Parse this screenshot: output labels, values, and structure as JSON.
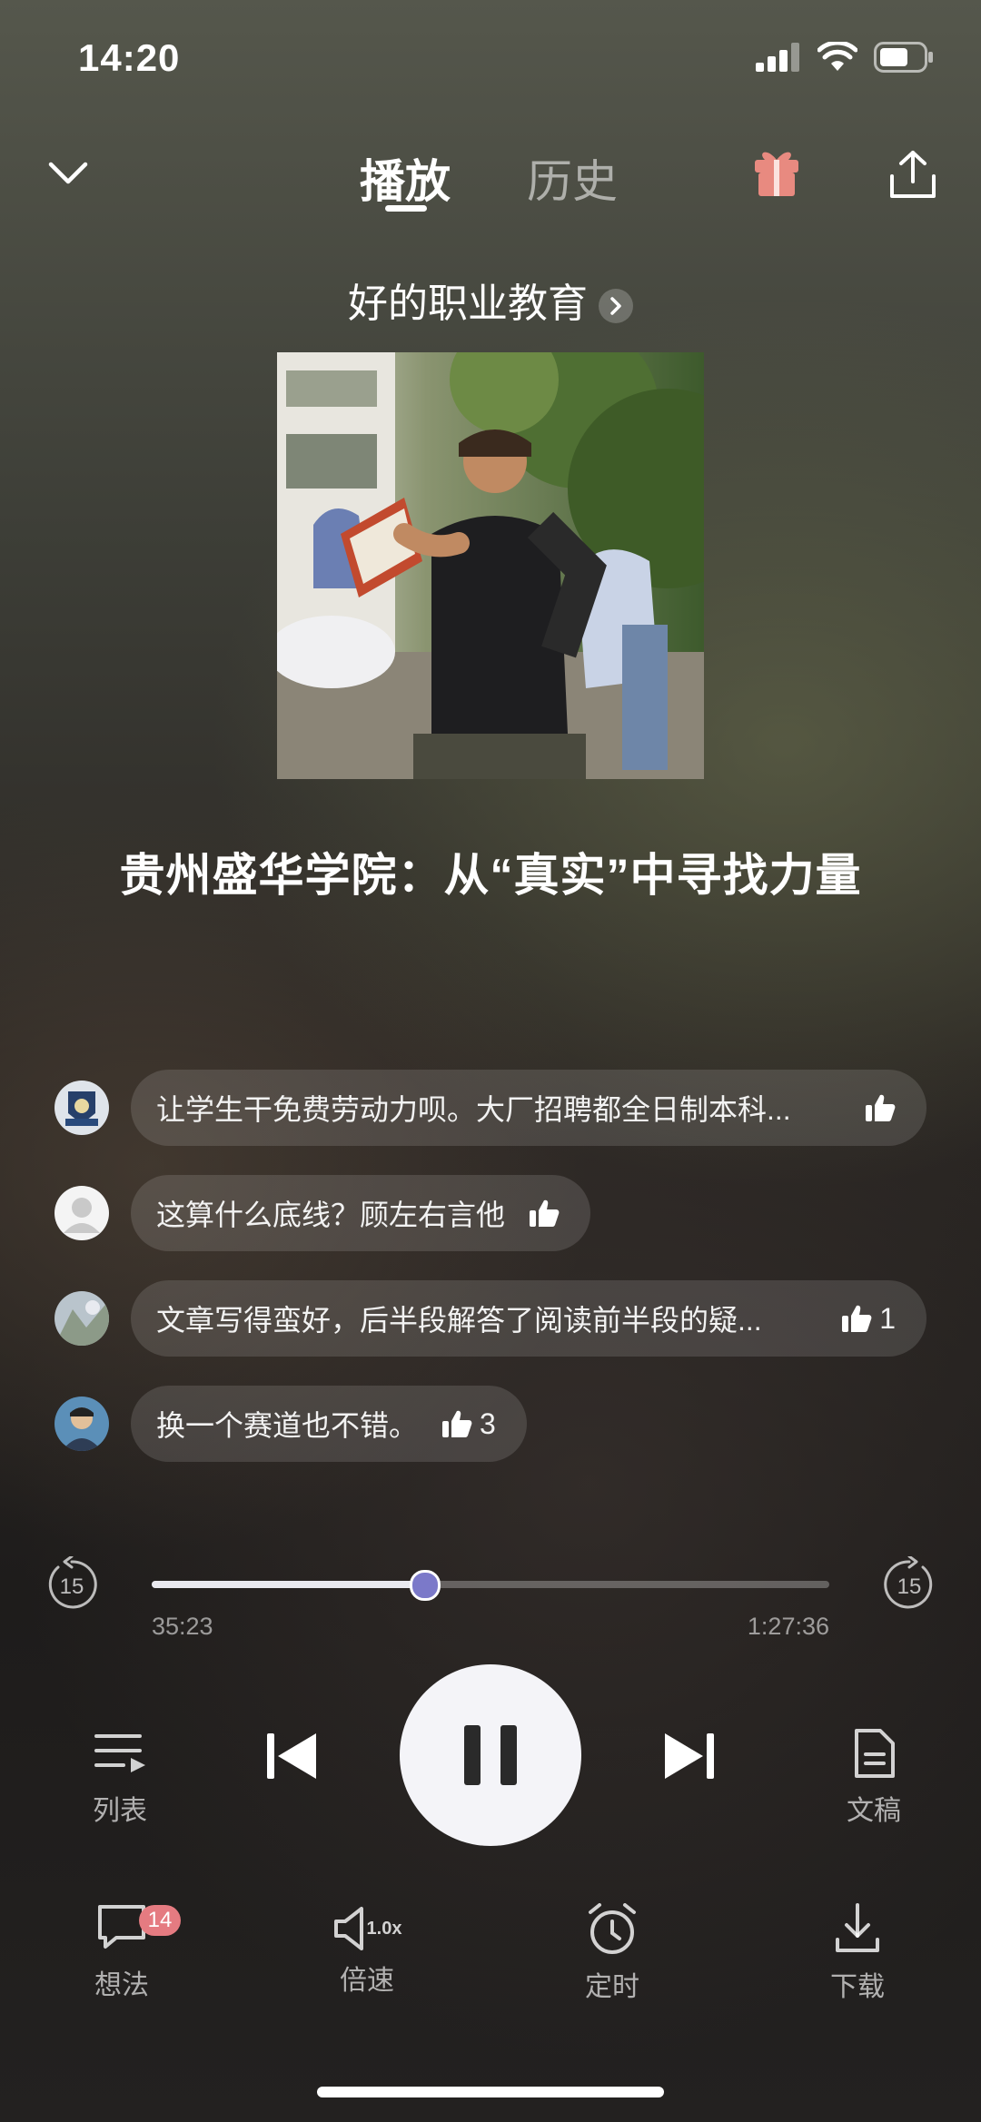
{
  "status_bar": {
    "time": "14:20"
  },
  "nav": {
    "tab_play": "播放",
    "tab_history": "历史"
  },
  "album": {
    "name": "好的职业教育"
  },
  "episode": {
    "title": "贵州盛华学院：从“真实”中寻找力量"
  },
  "comments": [
    {
      "text": "让学生干免费劳动力呗。大厂招聘都全日制本科...",
      "likes": ""
    },
    {
      "text": "这算什么底线？顾左右言他",
      "likes": ""
    },
    {
      "text": "文章写得蛮好，后半段解答了阅读前半段的疑...",
      "likes": "1"
    },
    {
      "text": "换一个赛道也不错。",
      "likes": "3"
    }
  ],
  "player": {
    "elapsed": "35:23",
    "total": "1:27:36",
    "progress_fraction": 0.403,
    "skip_back_seconds": "15",
    "skip_forward_seconds": "15"
  },
  "controls": {
    "list_label": "列表",
    "transcript_label": "文稿"
  },
  "bottom_bar": {
    "thoughts_label": "想法",
    "thoughts_count": "14",
    "speed_label": "倍速",
    "speed_value": "1.0x",
    "timer_label": "定时",
    "download_label": "下载"
  },
  "colors": {
    "progress_thumb": "#7b79c9",
    "badge": "#e57b81",
    "gift": "#e88a80"
  }
}
